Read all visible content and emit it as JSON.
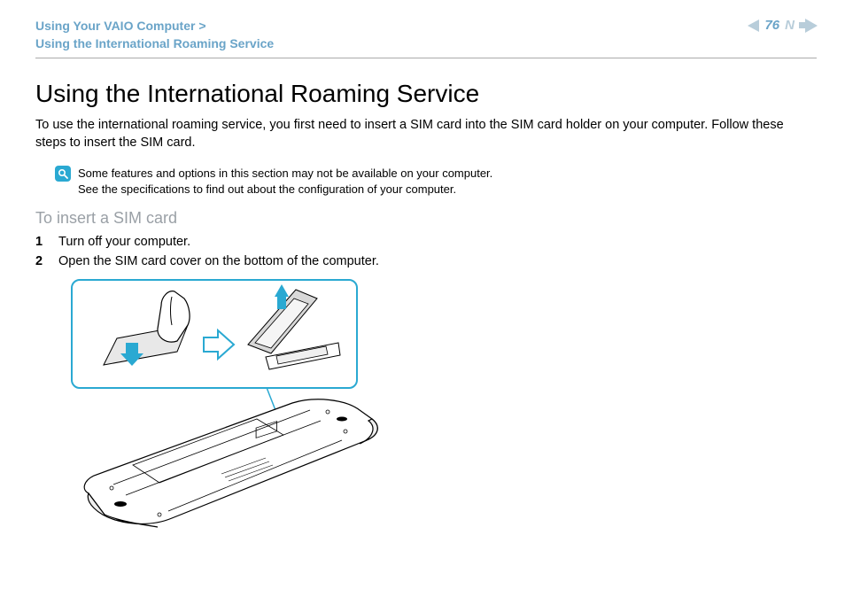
{
  "breadcrumb": {
    "line1": "Using Your VAIO Computer",
    "line2": "Using the International Roaming Service"
  },
  "page_number": "76",
  "nav_marker": "N",
  "heading": "Using the International Roaming Service",
  "intro": "To use the international roaming service, you first need to insert a SIM card into the SIM card holder on your computer. Follow these steps to insert the SIM card.",
  "note": {
    "line1": "Some features and options in this section may not be available on your computer.",
    "line2": "See the specifications to find out about the configuration of your computer."
  },
  "subhead": "To insert a SIM card",
  "steps": [
    "Turn off your computer.",
    "Open the SIM card cover on the bottom of the computer."
  ]
}
